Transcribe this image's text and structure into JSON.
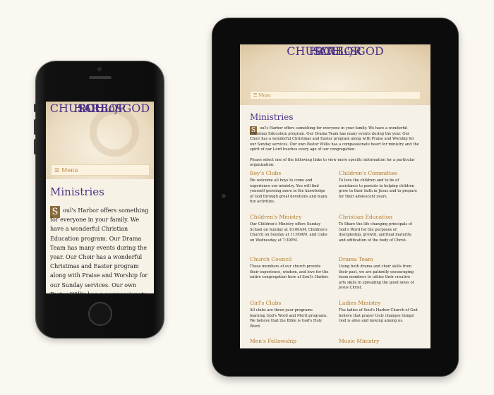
{
  "site": {
    "logo_line1": "SOUL'S",
    "logo_line2": "HARBOR",
    "logo_church": "CHURCH",
    "logo_of": "of",
    "logo_god": "GOD",
    "menu_label": "Menu",
    "menu_icon": "hamburger-icon"
  },
  "page": {
    "title": "Ministries",
    "drop_cap": "S",
    "phone_intro": "oul's Harbor offers something for everyone in your family. We have a wonderful Christian Education program. Our Drama Team has many events during the year. Our Choir has a wonderful Christmas and Easter program along with Praise and Worship for our Sunday services. Our own Pastor Willis has a compassionate heart for ministry and the spirit of our Lord touches every age of our",
    "tablet_intro": "oul's Harbor offers something for everyone in your family. We have a wonderful Christian Education program. Our Drama Team has many events during the year. Our Choir has a wonderful Christmas and Easter program along with Praise and Worship for our Sunday services. Our own Pastor Willis has a compassionate heart for ministry and the spirit of our Lord touches every age of our congregation.",
    "select_text": "Please select one of the following links to view more specific information for a particular organization:"
  },
  "organizations": [
    {
      "name": "Boy's Clubs",
      "desc": "We welcome all boys to come and experience our ministry. You will find yourself growing more in the knowledge of God through great devotions and many fun activities."
    },
    {
      "name": "Children's Committee",
      "desc": "To love the children and to be of assistance to parents in helping children grow in their faith in Jesus and to prepare for their adolescent years."
    },
    {
      "name": "Children's Ministry",
      "desc": "Our Children's Ministry offers Sunday School on Sunday at 10:00AM, Children's Church on Sunday at 11:00AM, and clubs on Wednesday at 7:30PM."
    },
    {
      "name": "Christian Education",
      "desc": "To Share the life changing principals of God's Word for the purposes of discipleship, growth, spiritual maturity, and edification of the body of Christ."
    },
    {
      "name": "Church Council",
      "desc": "These members of our church provide their experience, wisdom, and love for the entire congregation here at Soul's Harbor."
    },
    {
      "name": "Drama Team",
      "desc": "Using both drama and choir skills from their past, we are patiently encouraging team members to utilize their creative arts skills in spreading the good news of Jesus Christ."
    },
    {
      "name": "Girl's Clubs",
      "desc": "All clubs are three-year programs learning God's Word and Merit programs. We believe that the Bible is God's Holy Word."
    },
    {
      "name": "Ladies Ministry",
      "desc": "The ladies of Soul's Harbor Church of God believe that prayer truly changes things! God is alive and moving among us."
    },
    {
      "name": "Men's Fellowship",
      "desc": ""
    },
    {
      "name": "Music Ministry",
      "desc": ""
    }
  ],
  "colors": {
    "brand_purple": "#4a2f86",
    "accent_gold": "#b07a30",
    "background": "#fbf8f1"
  }
}
